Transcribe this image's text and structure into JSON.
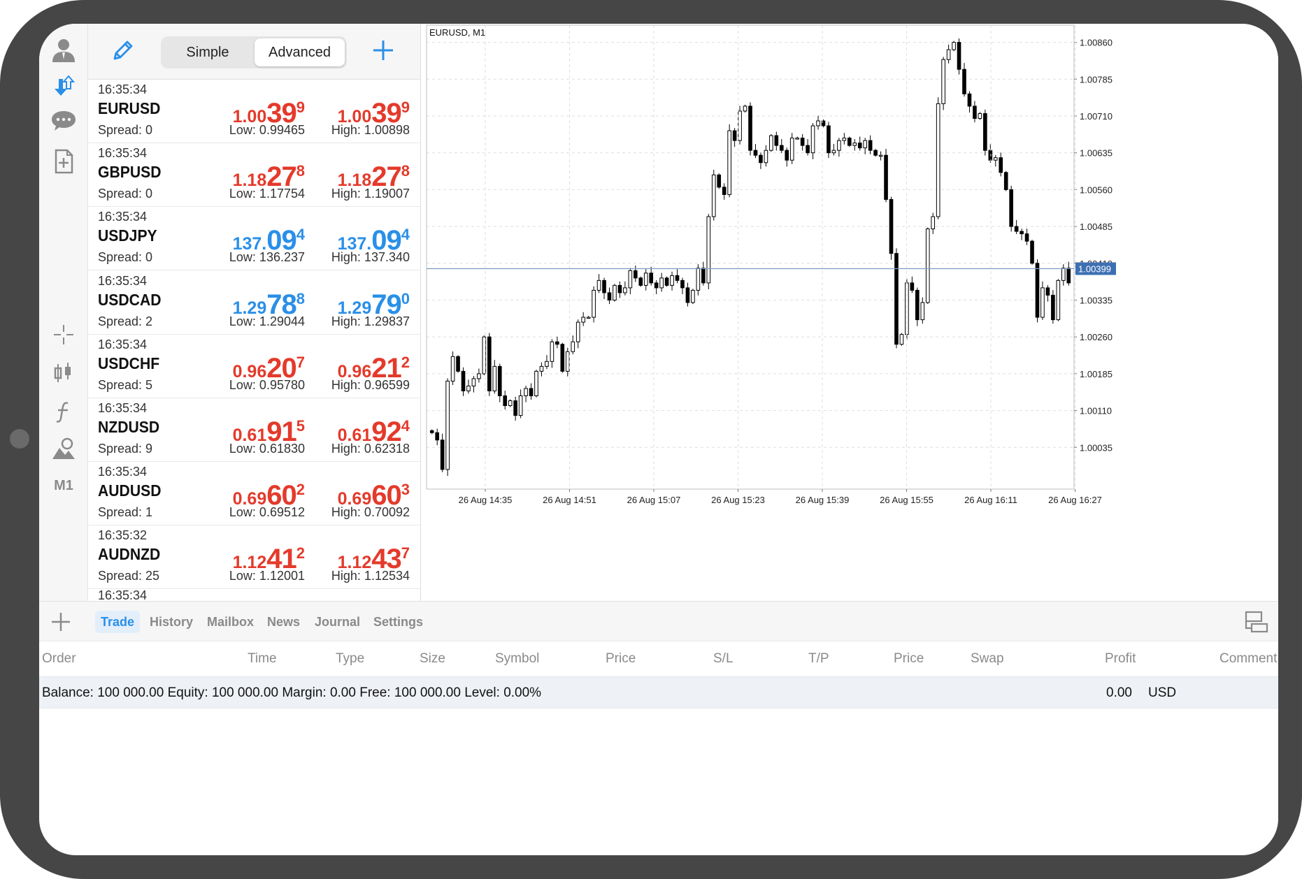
{
  "segmented": {
    "simple": "Simple",
    "advanced": "Advanced"
  },
  "rail": {
    "timeframe": "M1"
  },
  "quotes": [
    {
      "time": "16:35:34",
      "symbol": "EURUSD",
      "spread": "Spread: 0",
      "color": "red",
      "bid": {
        "small": "1.00",
        "big": "39",
        "sup": "9"
      },
      "ask": {
        "small": "1.00",
        "big": "39",
        "sup": "9"
      },
      "low": "Low: 0.99465",
      "high": "High: 1.00898"
    },
    {
      "time": "16:35:34",
      "symbol": "GBPUSD",
      "spread": "Spread: 0",
      "color": "red",
      "bid": {
        "small": "1.18",
        "big": "27",
        "sup": "8"
      },
      "ask": {
        "small": "1.18",
        "big": "27",
        "sup": "8"
      },
      "low": "Low: 1.17754",
      "high": "High: 1.19007"
    },
    {
      "time": "16:35:34",
      "symbol": "USDJPY",
      "spread": "Spread: 0",
      "color": "blue",
      "bid": {
        "small": "137.",
        "big": "09",
        "sup": "4"
      },
      "ask": {
        "small": "137.",
        "big": "09",
        "sup": "4"
      },
      "low": "Low: 136.237",
      "high": "High: 137.340"
    },
    {
      "time": "16:35:34",
      "symbol": "USDCAD",
      "spread": "Spread: 2",
      "color": "blue",
      "bid": {
        "small": "1.29",
        "big": "78",
        "sup": "8"
      },
      "ask": {
        "small": "1.29",
        "big": "79",
        "sup": "0"
      },
      "low": "Low: 1.29044",
      "high": "High: 1.29837"
    },
    {
      "time": "16:35:34",
      "symbol": "USDCHF",
      "spread": "Spread: 5",
      "color": "red",
      "bid": {
        "small": "0.96",
        "big": "20",
        "sup": "7"
      },
      "ask": {
        "small": "0.96",
        "big": "21",
        "sup": "2"
      },
      "low": "Low: 0.95780",
      "high": "High: 0.96599"
    },
    {
      "time": "16:35:34",
      "symbol": "NZDUSD",
      "spread": "Spread: 9",
      "color": "red",
      "bid": {
        "small": "0.61",
        "big": "91",
        "sup": "5"
      },
      "ask": {
        "small": "0.61",
        "big": "92",
        "sup": "4"
      },
      "low": "Low: 0.61830",
      "high": "High: 0.62318"
    },
    {
      "time": "16:35:34",
      "symbol": "AUDUSD",
      "spread": "Spread: 1",
      "color": "red",
      "bid": {
        "small": "0.69",
        "big": "60",
        "sup": "2"
      },
      "ask": {
        "small": "0.69",
        "big": "60",
        "sup": "3"
      },
      "low": "Low: 0.69512",
      "high": "High: 0.70092"
    },
    {
      "time": "16:35:32",
      "symbol": "AUDNZD",
      "spread": "Spread: 25",
      "color": "red",
      "bid": {
        "small": "1.12",
        "big": "41",
        "sup": "2"
      },
      "ask": {
        "small": "1.12",
        "big": "43",
        "sup": "7"
      },
      "low": "Low: 1.12001",
      "high": "High: 1.12534"
    }
  ],
  "chart": {
    "title": "EURUSD, M1"
  },
  "chart_data": {
    "type": "candlestick",
    "symbol": "EURUSD",
    "timeframe": "M1",
    "y_ticks": [
      "1.00860",
      "1.00785",
      "1.00710",
      "1.00635",
      "1.00560",
      "1.00485",
      "1.00410",
      "1.00335",
      "1.00260",
      "1.00185",
      "1.00110",
      "1.00035"
    ],
    "x_ticks": [
      "26 Aug 14:35",
      "26 Aug 14:51",
      "26 Aug 15:07",
      "26 Aug 15:23",
      "26 Aug 15:39",
      "26 Aug 15:55",
      "26 Aug 16:11",
      "26 Aug 16:27"
    ],
    "ylim": [
      0.9995,
      1.00895
    ],
    "current_price": 1.00399,
    "current_price_label": "1.00399",
    "closes": [
      1.00065,
      1.0005,
      0.9999,
      1.0017,
      1.0022,
      1.0019,
      1.0015,
      1.0016,
      1.00175,
      1.00185,
      1.0026,
      1.0015,
      1.002,
      1.0014,
      1.0012,
      1.0013,
      1.001,
      1.0014,
      1.00155,
      1.0014,
      1.0019,
      1.002,
      1.0021,
      1.0025,
      1.00245,
      1.0019,
      1.0023,
      1.0025,
      1.0029,
      1.003,
      1.003,
      1.00355,
      1.00375,
      1.0035,
      1.00335,
      1.00365,
      1.0035,
      1.0036,
      1.00395,
      1.0038,
      1.00365,
      1.0039,
      1.0037,
      1.0036,
      1.0038,
      1.00365,
      1.00385,
      1.00375,
      1.0036,
      1.0033,
      1.00355,
      1.004,
      1.0037,
      1.00505,
      1.0059,
      1.00565,
      1.0055,
      1.0068,
      1.0066,
      1.0072,
      1.0073,
      1.0064,
      1.0063,
      1.00615,
      1.0064,
      1.0067,
      1.0065,
      1.0064,
      1.0062,
      1.00665,
      1.00665,
      1.0065,
      1.00635,
      1.0069,
      1.007,
      1.0069,
      1.00635,
      1.0064,
      1.0066,
      1.00665,
      1.0065,
      1.00655,
      1.00645,
      1.0066,
      1.0064,
      1.0063,
      1.0063,
      1.0054,
      1.0043,
      1.00245,
      1.00265,
      1.0037,
      1.00355,
      1.00295,
      1.0033,
      1.0048,
      1.00505,
      1.00735,
      1.00825,
      1.00845,
      1.0086,
      1.00805,
      1.00755,
      1.0073,
      1.00705,
      1.00715,
      1.0064,
      1.0062,
      1.00625,
      1.00595,
      1.0056,
      1.00485,
      1.00475,
      1.0047,
      1.00455,
      1.0041,
      1.003,
      1.0036,
      1.00345,
      1.00295,
      1.00375,
      1.004,
      1.0037
    ]
  },
  "toolbox": {
    "tabs": [
      "Trade",
      "History",
      "Mailbox",
      "News",
      "Journal",
      "Settings"
    ],
    "columns": [
      "Order",
      "Time",
      "Type",
      "Size",
      "Symbol",
      "Price",
      "S/L",
      "T/P",
      "Price",
      "Swap",
      "Profit",
      "Comment"
    ],
    "balance_line": "Balance: 100 000.00 Equity: 100 000.00 Margin: 0.00 Free: 100 000.00 Level: 0.00%",
    "profit": "0.00",
    "currency": "USD"
  },
  "colors": {
    "bid_red": "#e43a2b",
    "bid_blue": "#2a8fe8",
    "accent": "#2a8fe8",
    "price_line": "#7e9bc6"
  }
}
